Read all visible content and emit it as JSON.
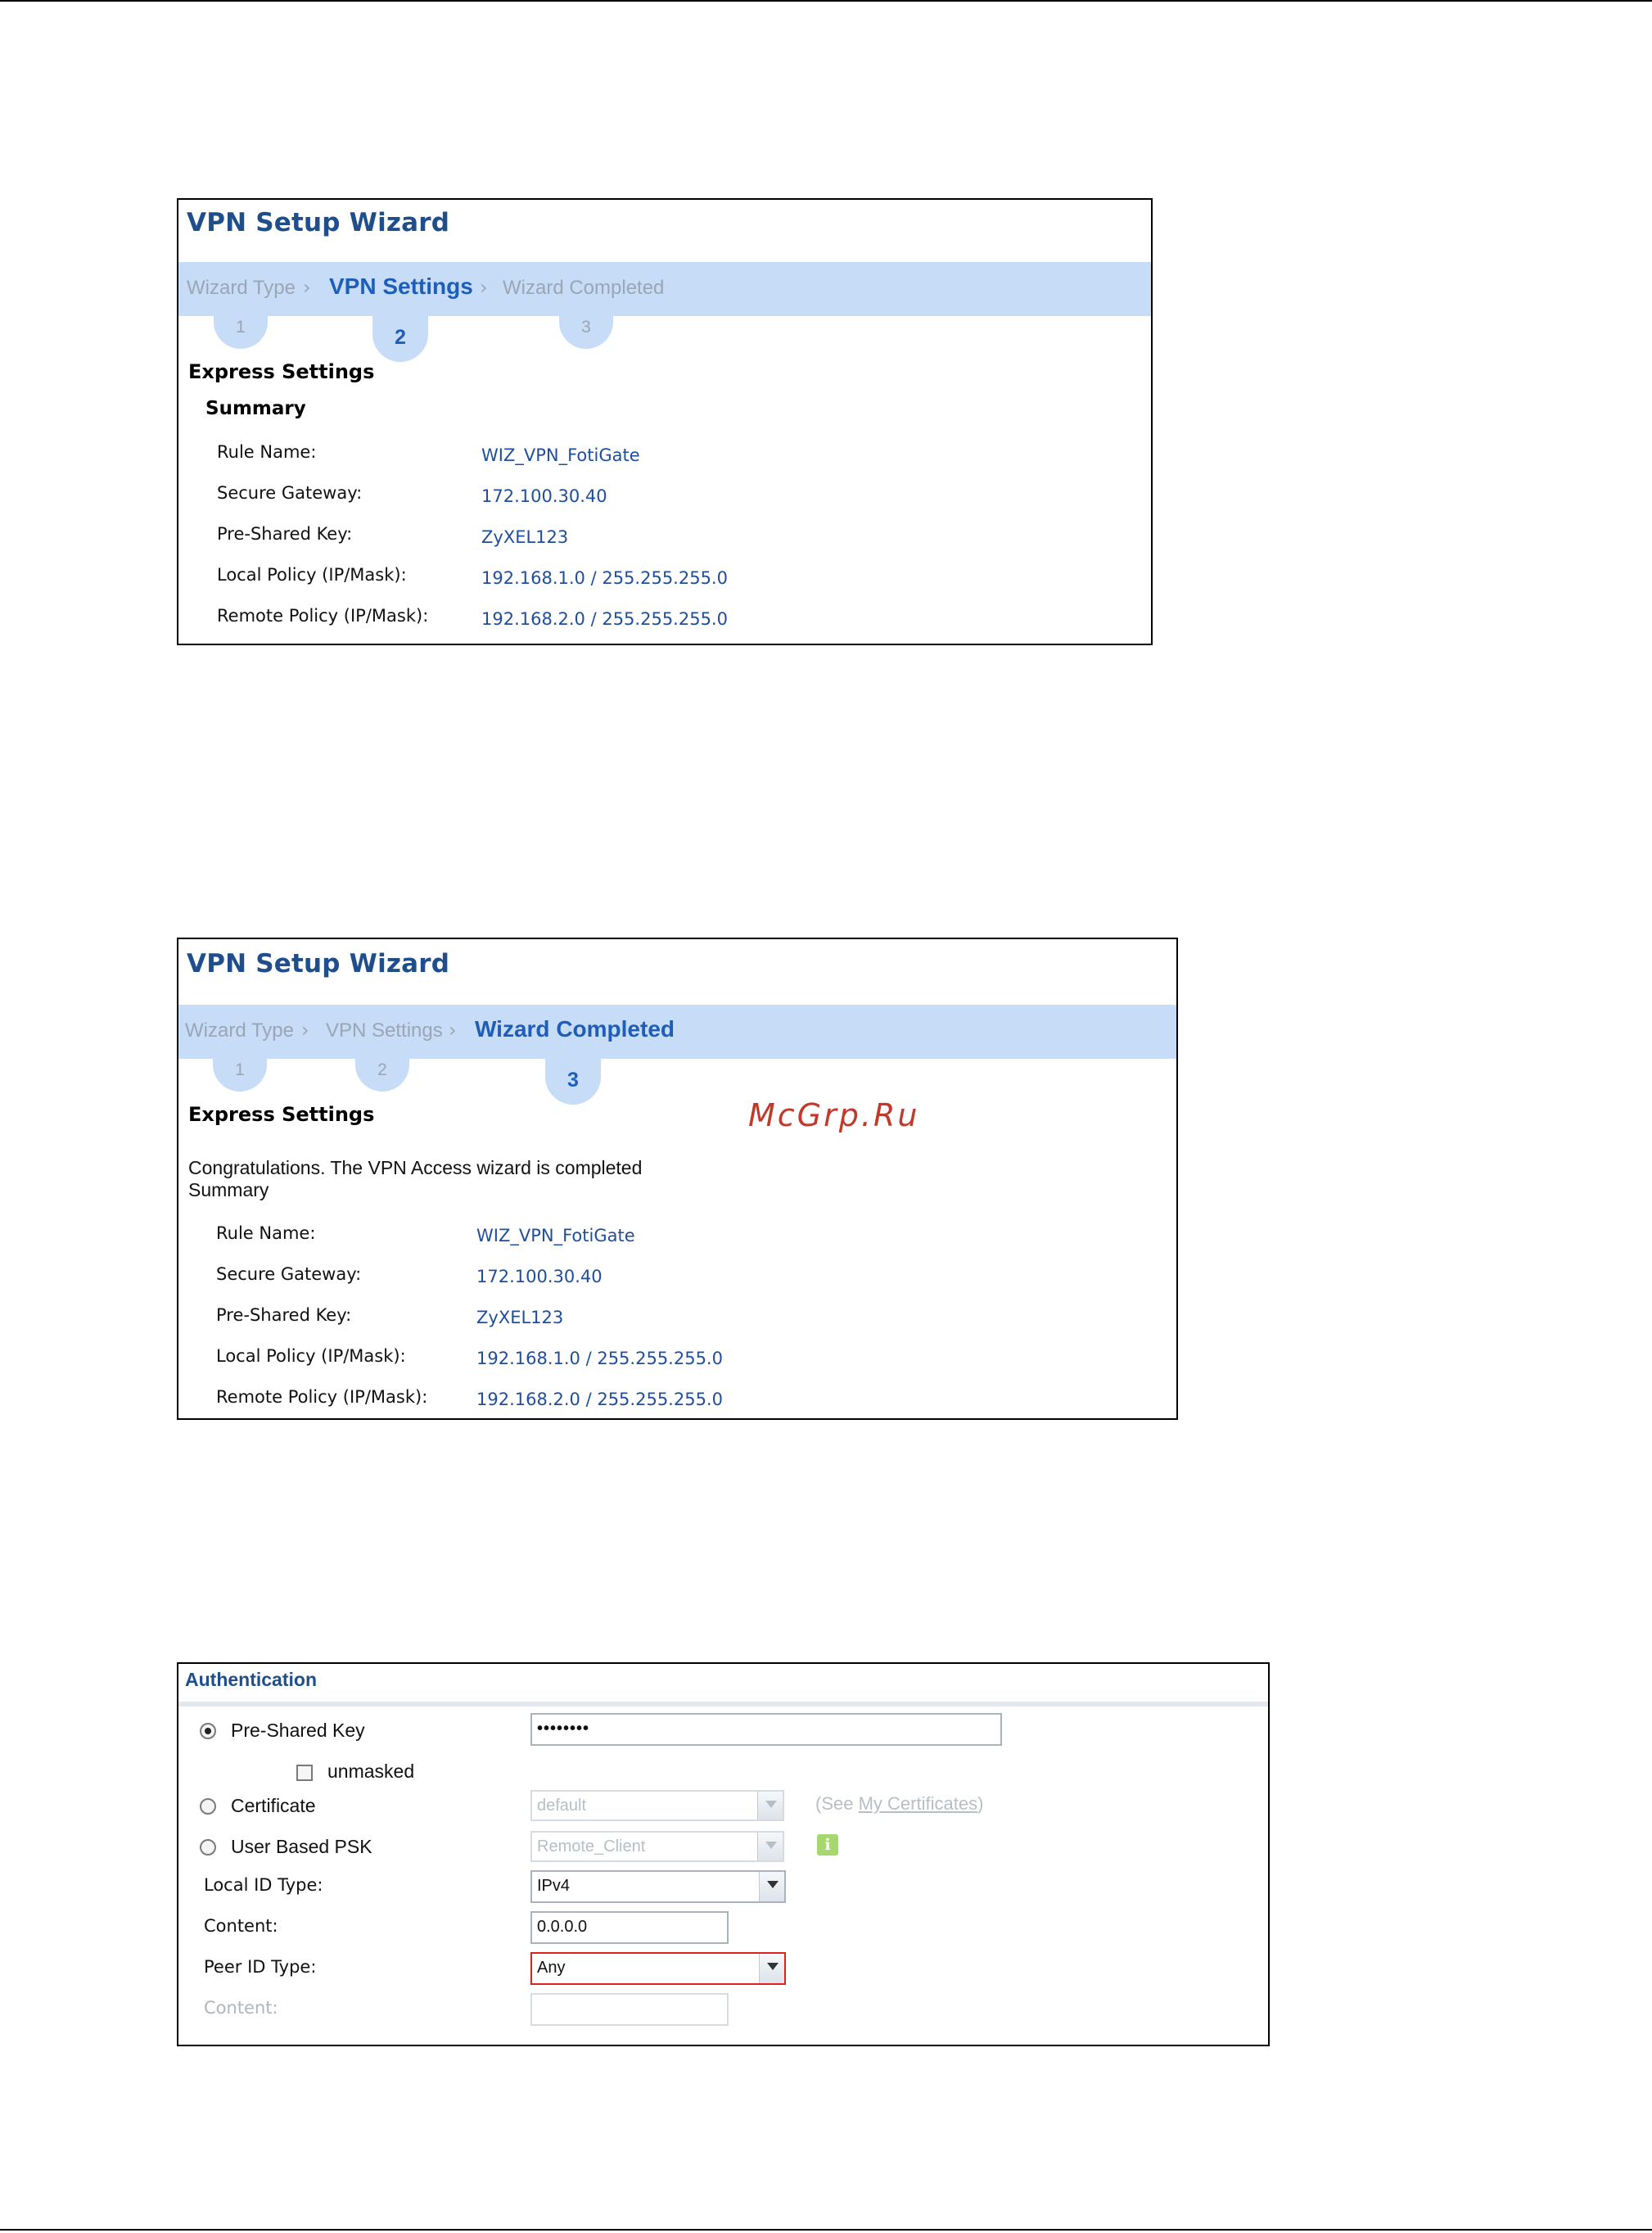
{
  "watermark": "McGrp.Ru",
  "wizard1": {
    "title": "VPN Setup Wizard",
    "steps": [
      {
        "label": "Wizard Type",
        "number": "1"
      },
      {
        "label": "VPN Settings",
        "number": "2"
      },
      {
        "label": "Wizard Completed",
        "number": "3"
      }
    ],
    "section": "Express Settings",
    "summary_heading": "Summary",
    "rows": [
      {
        "label": "Rule Name:",
        "value": "WIZ_VPN_FotiGate"
      },
      {
        "label": "Secure Gateway:",
        "value": "172.100.30.40"
      },
      {
        "label": "Pre-Shared Key:",
        "value": "ZyXEL123"
      },
      {
        "label": "Local Policy (IP/Mask):",
        "value": "192.168.1.0 / 255.255.255.0"
      },
      {
        "label": "Remote Policy (IP/Mask):",
        "value": "192.168.2.0 / 255.255.255.0"
      }
    ]
  },
  "wizard2": {
    "title": "VPN Setup Wizard",
    "steps": [
      {
        "label": "Wizard Type",
        "number": "1"
      },
      {
        "label": "VPN Settings",
        "number": "2"
      },
      {
        "label": "Wizard Completed",
        "number": "3"
      }
    ],
    "section": "Express Settings",
    "message_line1": "Congratulations. The VPN Access wizard is completed",
    "message_line2": "Summary",
    "rows": [
      {
        "label": "Rule Name:",
        "value": "WIZ_VPN_FotiGate"
      },
      {
        "label": "Secure Gateway:",
        "value": "172.100.30.40"
      },
      {
        "label": "Pre-Shared Key:",
        "value": "ZyXEL123"
      },
      {
        "label": "Local Policy (IP/Mask):",
        "value": "192.168.1.0 / 255.255.255.0"
      },
      {
        "label": "Remote Policy (IP/Mask):",
        "value": "192.168.2.0 / 255.255.255.0"
      }
    ]
  },
  "auth": {
    "title": "Authentication",
    "pre_shared_key_label": "Pre-Shared Key",
    "pre_shared_key_value": "••••••••",
    "unmasked_label": "unmasked",
    "certificate_label": "Certificate",
    "certificate_value": "default",
    "see_prefix": "(See ",
    "see_link": "My Certificates",
    "see_suffix": ")",
    "user_psk_label": "User Based PSK",
    "user_psk_value": "Remote_Client",
    "info_icon_glyph": "i",
    "local_id_type_label": "Local ID Type:",
    "local_id_type_value": "IPv4",
    "content_label": "Content:",
    "content_value": "0.0.0.0",
    "peer_id_type_label": "Peer ID Type:",
    "peer_id_type_value": "Any",
    "peer_content_label": "Content:",
    "peer_content_value": ""
  }
}
